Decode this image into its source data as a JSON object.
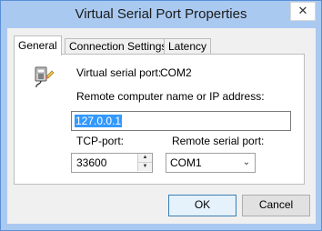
{
  "window": {
    "title": "Virtual Serial Port Properties",
    "close_glyph": "✕",
    "title_bg": "#a9c9f0"
  },
  "tabs": [
    {
      "label": "General",
      "active": true
    },
    {
      "label": "Connection Settings",
      "active": false
    },
    {
      "label": "Latency",
      "active": false
    }
  ],
  "general": {
    "icon": "serial-port-device-icon",
    "virtual_port_label": "Virtual serial port:",
    "virtual_port_value": "COM2",
    "remote_host_label": "Remote computer name or IP address:",
    "remote_host_value": "127.0.0.1",
    "tcp_port_label": "TCP-port:",
    "tcp_port_value": "33600",
    "remote_serial_label": "Remote serial port:",
    "remote_serial_value": "COM1"
  },
  "buttons": {
    "ok": "OK",
    "cancel": "Cancel"
  },
  "colors": {
    "selection": "#3399ff",
    "dialog_bg": "#f0f0f0"
  }
}
